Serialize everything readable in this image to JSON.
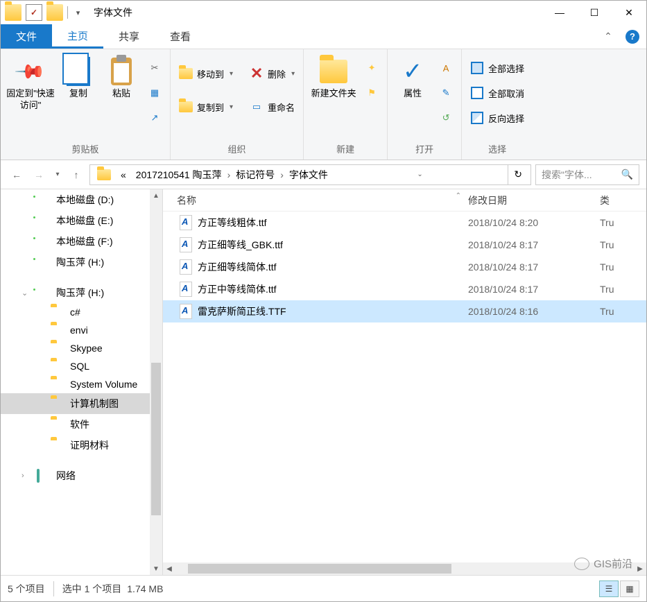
{
  "title": "字体文件",
  "tabs": {
    "file": "文件",
    "home": "主页",
    "share": "共享",
    "view": "查看"
  },
  "ribbon": {
    "clipboard": {
      "pin": "固定到\"快速访问\"",
      "copy": "复制",
      "paste": "粘贴",
      "cut": "剪切",
      "copypath": "复制路径",
      "shortcut": "粘贴快捷方式",
      "label": "剪贴板"
    },
    "organize": {
      "moveto": "移动到",
      "copyto": "复制到",
      "delete": "删除",
      "rename": "重命名",
      "label": "组织"
    },
    "new": {
      "newfolder": "新建文件夹",
      "newitem": "新建项目",
      "easyaccess": "轻松访问",
      "label": "新建"
    },
    "open": {
      "properties": "属性",
      "open": "打开",
      "edit": "编辑",
      "history": "历史记录",
      "label": "打开"
    },
    "select": {
      "all": "全部选择",
      "none": "全部取消",
      "invert": "反向选择",
      "label": "选择"
    }
  },
  "breadcrumb": [
    "«",
    "2017210541 陶玉萍",
    "标记符号",
    "字体文件"
  ],
  "search_placeholder": "搜索\"字体...",
  "columns": {
    "name": "名称",
    "date": "修改日期",
    "type": "类"
  },
  "files": [
    {
      "name": "方正等线粗体.ttf",
      "date": "2018/10/24 8:20",
      "type": "Tru"
    },
    {
      "name": "方正细等线_GBK.ttf",
      "date": "2018/10/24 8:17",
      "type": "Tru"
    },
    {
      "name": "方正细等线简体.ttf",
      "date": "2018/10/24 8:17",
      "type": "Tru"
    },
    {
      "name": "方正中等线简体.ttf",
      "date": "2018/10/24 8:17",
      "type": "Tru"
    },
    {
      "name": "雷克萨斯简正线.TTF",
      "date": "2018/10/24 8:16",
      "type": "Tru"
    }
  ],
  "tree": {
    "drives": [
      "本地磁盘 (D:)",
      "本地磁盘 (E:)",
      "本地磁盘 (F:)",
      "陶玉萍 (H:)"
    ],
    "expanded_drive": "陶玉萍 (H:)",
    "folders": [
      "c#",
      "envi",
      "Skypee",
      "SQL",
      "System Volume",
      "计算机制图",
      "软件",
      "证明材料"
    ],
    "selected": "计算机制图",
    "network": "网络"
  },
  "status": {
    "items": "5 个项目",
    "selected": "选中 1 个项目",
    "size": "1.74 MB"
  },
  "watermark": "GIS前沿"
}
